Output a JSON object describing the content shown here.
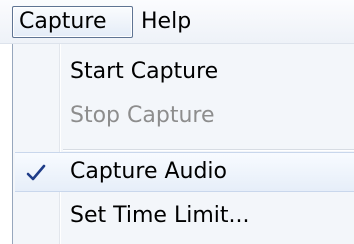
{
  "menubar": {
    "items": [
      {
        "label": "Capture",
        "active": true
      },
      {
        "label": "Help",
        "active": false
      }
    ]
  },
  "capture_menu": {
    "items": [
      {
        "label": "Start Capture",
        "enabled": true,
        "checked": false
      },
      {
        "label": "Stop Capture",
        "enabled": false,
        "checked": false
      },
      {
        "label": "Capture Audio",
        "enabled": true,
        "checked": true,
        "icon": "checkmark-icon"
      },
      {
        "label": "Set Time Limit...",
        "enabled": true,
        "checked": false
      }
    ]
  },
  "colors": {
    "check_mark": "#1f3c88",
    "disabled_text": "#8d8d8d",
    "active_border": "#5f7493"
  }
}
